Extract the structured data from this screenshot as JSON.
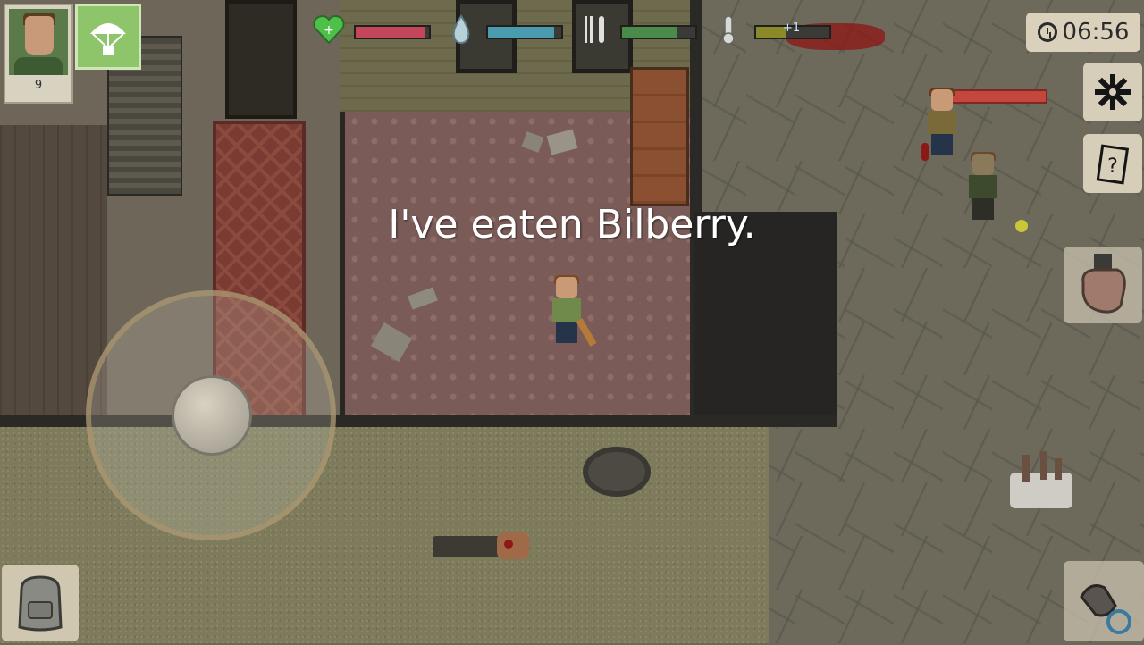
{
  "hud": {
    "player_level": "9",
    "clock_time": "06:56",
    "stats": [
      {
        "name": "health",
        "icon": "heart-icon",
        "color": "#c4465a",
        "level": 0.95
      },
      {
        "name": "thirst",
        "icon": "water-drop-icon",
        "color": "#4a9ab0",
        "level": 0.9
      },
      {
        "name": "hunger",
        "icon": "fork-knife-icon",
        "color": "#4a8a4a",
        "level": 0.75
      },
      {
        "name": "temperature",
        "icon": "thermometer-icon",
        "color": "#8a8a2a",
        "level": 0.4
      }
    ],
    "temperature_change": "+1"
  },
  "notification": {
    "message": "I've eaten Bilberry."
  },
  "colors": {
    "airdrop_bg": "#8ec56a",
    "button_bg": "#d6ceb8",
    "enemy_health": "#c4463d"
  },
  "buttons": {
    "settings": "gear-icon",
    "journal": "journal-icon",
    "backpack": "backpack-icon",
    "fist": "fist-icon",
    "attack": "attack-icon",
    "airdrop": "parachute-icon"
  }
}
